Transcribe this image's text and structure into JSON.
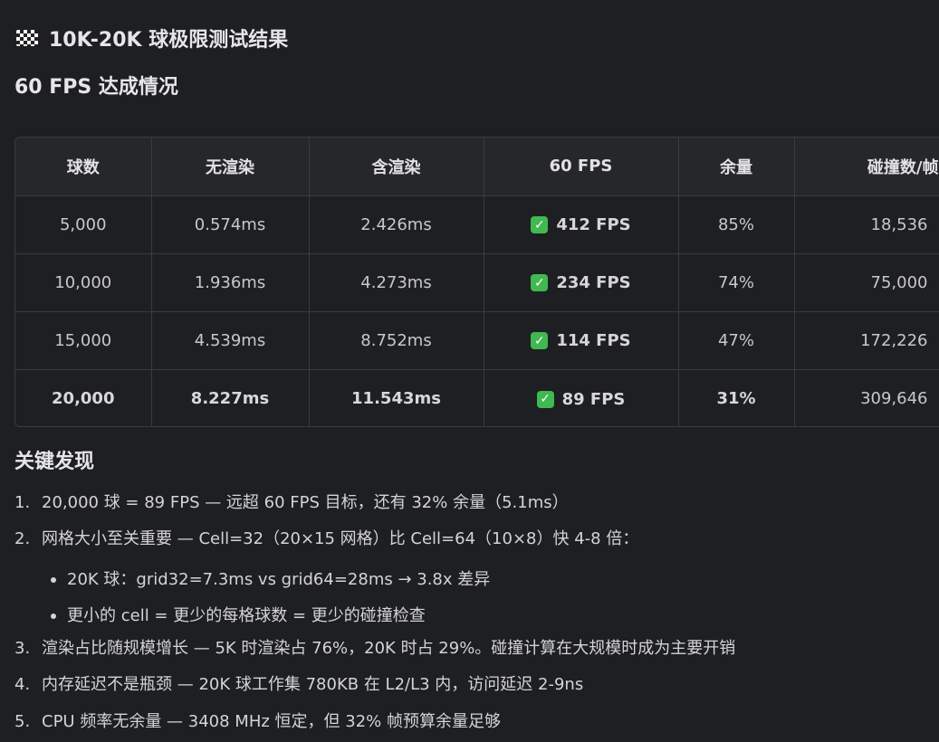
{
  "title": {
    "icon": "checkered-flag-icon",
    "text": "10K-20K 球极限测试结果"
  },
  "section_fps": "60 FPS 达成情况",
  "table": {
    "headers": [
      "球数",
      "无渲染",
      "含渲染",
      "60 FPS",
      "余量",
      "碰撞数/帧"
    ],
    "rows": [
      {
        "balls": "5,000",
        "no_render": "0.574ms",
        "with_render": "2.426ms",
        "fps": "412 FPS",
        "margin": "85%",
        "collisions": "18,536"
      },
      {
        "balls": "10,000",
        "no_render": "1.936ms",
        "with_render": "4.273ms",
        "fps": "234 FPS",
        "margin": "74%",
        "collisions": "75,000"
      },
      {
        "balls": "15,000",
        "no_render": "4.539ms",
        "with_render": "8.752ms",
        "fps": "114 FPS",
        "margin": "47%",
        "collisions": "172,226"
      },
      {
        "balls": "20,000",
        "no_render": "8.227ms",
        "with_render": "11.543ms",
        "fps": "89 FPS",
        "margin": "31%",
        "collisions": "309,646"
      }
    ],
    "check_icon": "check-box-icon",
    "check_color": "#3fb950"
  },
  "section_findings": "关键发现",
  "findings": [
    {
      "num": "1.",
      "text": "20,000 球 = 89 FPS — 远超 60 FPS 目标，还有 32% 余量（5.1ms）"
    },
    {
      "num": "2.",
      "text": "网格大小至关重要 — Cell=32（20×15 网格）比 Cell=64（10×8）快 4-8 倍："
    },
    {
      "num": "3.",
      "text": "渲染占比随规模增长 — 5K 时渲染占 76%，20K 时占 29%。碰撞计算在大规模时成为主要开销"
    },
    {
      "num": "4.",
      "text": "内存延迟不是瓶颈 — 20K 球工作集 780KB 在 L2/L3 内，访问延迟 2-9ns"
    },
    {
      "num": "5.",
      "text": "CPU 频率无余量 — 3408 MHz 恒定，但 32% 帧预算余量足够"
    }
  ],
  "sub_findings": [
    "20K 球：grid32=7.3ms vs grid64=28ms → 3.8x 差异",
    "更小的 cell = 更少的每格球数 = 更少的碰撞检查"
  ]
}
